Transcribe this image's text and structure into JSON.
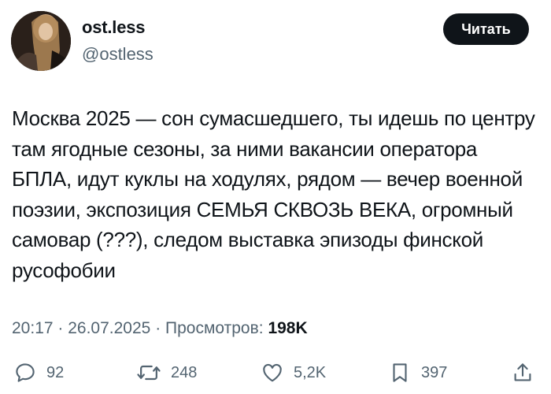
{
  "author": {
    "name": "ost.less",
    "handle": "@ostless"
  },
  "header": {
    "read_label": "Читать"
  },
  "tweet": {
    "text": "Москва 2025 — сон сумасшедшего, ты идешь по центру там ягодные сезоны, за ними вакансии оператора БПЛА, идут куклы на ходулях, рядом — вечер военной поэзии, экспозиция СЕМЬЯ СКВОЗЬ ВЕКА, огромный самовар (???), следом выставка эпизоды финской русофобии"
  },
  "meta": {
    "time": "20:17",
    "date": "26.07.2025",
    "views_label": "Просмотров:",
    "views_count": "198K"
  },
  "actions": {
    "replies": "92",
    "reposts": "248",
    "likes": "5,2K",
    "bookmarks": "397"
  },
  "icons": {
    "reply": "speech-bubble-icon",
    "repost": "repost-arrows-icon",
    "like": "heart-icon",
    "bookmark": "bookmark-icon",
    "share": "share-upload-icon"
  },
  "colors": {
    "text": "#0f1419",
    "secondary": "#536471",
    "button_bg": "#0f1419",
    "button_text": "#ffffff"
  }
}
